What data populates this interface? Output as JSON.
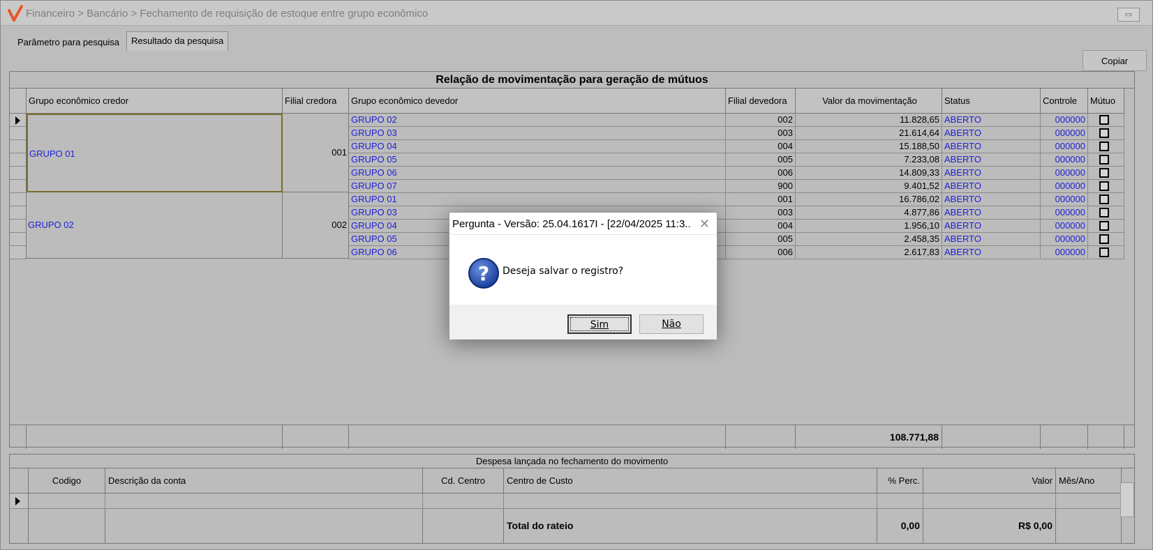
{
  "window": {
    "title": "Financeiro > Bancário > Fechamento de requisição de estoque entre grupo econômico"
  },
  "tabs": [
    {
      "label": "Parâmetro para pesquisa"
    },
    {
      "label": "Resultado da pesquisa"
    }
  ],
  "toolbar": {
    "copy_label": "Copiar"
  },
  "main_grid": {
    "caption": "Relação de movimentação para geração de mútuos",
    "columns": [
      "Grupo econômico credor",
      "Filial credora",
      "Grupo econômico devedor",
      "Filial devedora",
      "Valor da movimentação",
      "Status",
      "Controle",
      "Mútuo"
    ],
    "groups": [
      {
        "credor": "GRUPO 01",
        "filial": "001"
      },
      {
        "credor": "GRUPO 02",
        "filial": "002"
      }
    ],
    "rows": [
      {
        "devedor": "GRUPO 02",
        "filial": "002",
        "valor": "11.828,65",
        "status": "ABERTO",
        "controle": "000000"
      },
      {
        "devedor": "GRUPO 03",
        "filial": "003",
        "valor": "21.614,64",
        "status": "ABERTO",
        "controle": "000000"
      },
      {
        "devedor": "GRUPO 04",
        "filial": "004",
        "valor": "15.188,50",
        "status": "ABERTO",
        "controle": "000000"
      },
      {
        "devedor": "GRUPO 05",
        "filial": "005",
        "valor": "7.233,08",
        "status": "ABERTO",
        "controle": "000000"
      },
      {
        "devedor": "GRUPO 06",
        "filial": "006",
        "valor": "14.809,33",
        "status": "ABERTO",
        "controle": "000000"
      },
      {
        "devedor": "GRUPO 07",
        "filial": "900",
        "valor": "9.401,52",
        "status": "ABERTO",
        "controle": "000000"
      },
      {
        "devedor": "GRUPO 01",
        "filial": "001",
        "valor": "16.786,02",
        "status": "ABERTO",
        "controle": "000000"
      },
      {
        "devedor": "GRUPO 03",
        "filial": "003",
        "valor": "4.877,86",
        "status": "ABERTO",
        "controle": "000000"
      },
      {
        "devedor": "GRUPO 04",
        "filial": "004",
        "valor": "1.956,10",
        "status": "ABERTO",
        "controle": "000000"
      },
      {
        "devedor": "GRUPO 05",
        "filial": "005",
        "valor": "2.458,35",
        "status": "ABERTO",
        "controle": "000000"
      },
      {
        "devedor": "GRUPO 06",
        "filial": "006",
        "valor": "2.617,83",
        "status": "ABERTO",
        "controle": "000000"
      }
    ],
    "total": "108.771,88"
  },
  "expense_grid": {
    "caption": "Despesa lançada no fechamento do movimento",
    "columns": [
      "Codigo",
      "Descrição da conta",
      "Cd. Centro",
      "Centro de Custo",
      "% Perc.",
      "Valor",
      "Mês/Ano"
    ],
    "total_label": "Total do rateio",
    "total_perc": "0,00",
    "total_valor": "R$ 0,00"
  },
  "dialog": {
    "title": "Pergunta - Versão: 25.04.1617I - [22/04/2025 11:3...",
    "message": "Deseja salvar o registro?",
    "yes_label": "Sim",
    "no_label": "Não"
  },
  "colors": {
    "link_blue": "#2020d6",
    "logo_orange": "#e8562a"
  }
}
